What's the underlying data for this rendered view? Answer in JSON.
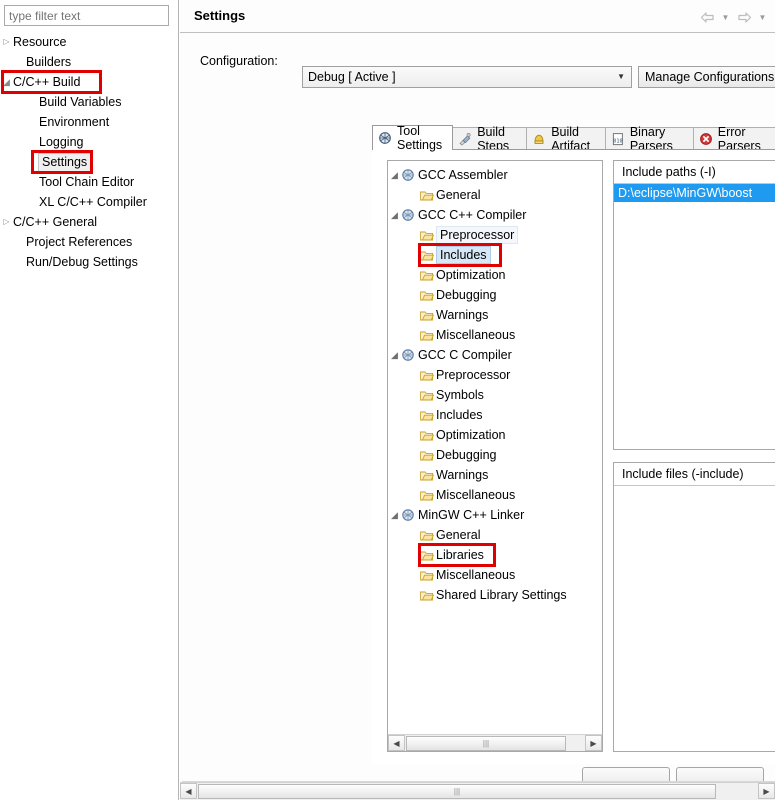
{
  "sidebar": {
    "filter": {
      "placeholder": "type filter text",
      "value": ""
    },
    "items": [
      {
        "label": "Resource",
        "arrow": "collapsed",
        "indent": 4,
        "selected": false,
        "boxed": false
      },
      {
        "label": "Builders",
        "arrow": "none",
        "indent": 17,
        "selected": false,
        "boxed": false
      },
      {
        "label": "C/C++ Build",
        "arrow": "expanded",
        "indent": 4,
        "selected": false,
        "boxed": true
      },
      {
        "label": "Build Variables",
        "arrow": "none",
        "indent": 30,
        "selected": false,
        "boxed": false
      },
      {
        "label": "Environment",
        "arrow": "none",
        "indent": 30,
        "selected": false,
        "boxed": false
      },
      {
        "label": "Logging",
        "arrow": "none",
        "indent": 30,
        "selected": false,
        "boxed": false
      },
      {
        "label": "Settings",
        "arrow": "none",
        "indent": 30,
        "selected": true,
        "boxed": true
      },
      {
        "label": "Tool Chain Editor",
        "arrow": "none",
        "indent": 30,
        "selected": false,
        "boxed": false
      },
      {
        "label": "XL C/C++ Compiler",
        "arrow": "none",
        "indent": 30,
        "selected": false,
        "boxed": false
      },
      {
        "label": "C/C++ General",
        "arrow": "collapsed",
        "indent": 4,
        "selected": false,
        "boxed": false
      },
      {
        "label": "Project References",
        "arrow": "none",
        "indent": 17,
        "selected": false,
        "boxed": false
      },
      {
        "label": "Run/Debug Settings",
        "arrow": "none",
        "indent": 17,
        "selected": false,
        "boxed": false
      }
    ]
  },
  "header": {
    "title": "Settings",
    "back_icon": "back-arrow-icon",
    "back_caret_icon": "chevron-down-icon",
    "forward_icon": "forward-arrow-icon",
    "forward_caret_icon": "chevron-down-icon"
  },
  "config": {
    "label": "Configuration:",
    "value": "Debug  [ Active ]",
    "caret_icon": "chevron-down-icon",
    "manage_button": "Manage Configurations..."
  },
  "tabs": [
    {
      "label": "Tool Settings",
      "icon": "tool-settings-icon",
      "active": true
    },
    {
      "label": "Build Steps",
      "icon": "build-steps-icon",
      "active": false
    },
    {
      "label": "Build Artifact",
      "icon": "build-artifact-icon",
      "active": false
    },
    {
      "label": "Binary Parsers",
      "icon": "binary-parsers-icon",
      "active": false
    },
    {
      "label": "Error Parsers",
      "icon": "error-parsers-icon",
      "active": false
    }
  ],
  "tool_tree": [
    {
      "label": "GCC Assembler",
      "arrow": "expanded",
      "indent": 6,
      "icon": "tool-gear-icon",
      "state": "normal",
      "boxed": false
    },
    {
      "label": "General",
      "arrow": "none",
      "indent": 24,
      "icon": "folder-icon",
      "state": "normal",
      "boxed": false
    },
    {
      "label": "GCC C++ Compiler",
      "arrow": "expanded",
      "indent": 6,
      "icon": "tool-gear-icon",
      "state": "normal",
      "boxed": false
    },
    {
      "label": "Preprocessor",
      "arrow": "none",
      "indent": 24,
      "icon": "folder-icon",
      "state": "faint",
      "boxed": false
    },
    {
      "label": "Includes",
      "arrow": "none",
      "indent": 24,
      "icon": "folder-icon",
      "state": "selected",
      "boxed": true
    },
    {
      "label": "Optimization",
      "arrow": "none",
      "indent": 24,
      "icon": "folder-icon",
      "state": "normal",
      "boxed": false
    },
    {
      "label": "Debugging",
      "arrow": "none",
      "indent": 24,
      "icon": "folder-icon",
      "state": "normal",
      "boxed": false
    },
    {
      "label": "Warnings",
      "arrow": "none",
      "indent": 24,
      "icon": "folder-icon",
      "state": "normal",
      "boxed": false
    },
    {
      "label": "Miscellaneous",
      "arrow": "none",
      "indent": 24,
      "icon": "folder-icon",
      "state": "normal",
      "boxed": false
    },
    {
      "label": "GCC C Compiler",
      "arrow": "expanded",
      "indent": 6,
      "icon": "tool-gear-icon",
      "state": "normal",
      "boxed": false
    },
    {
      "label": "Preprocessor",
      "arrow": "none",
      "indent": 24,
      "icon": "folder-icon",
      "state": "normal",
      "boxed": false
    },
    {
      "label": "Symbols",
      "arrow": "none",
      "indent": 24,
      "icon": "folder-icon",
      "state": "normal",
      "boxed": false
    },
    {
      "label": "Includes",
      "arrow": "none",
      "indent": 24,
      "icon": "folder-icon",
      "state": "normal",
      "boxed": false
    },
    {
      "label": "Optimization",
      "arrow": "none",
      "indent": 24,
      "icon": "folder-icon",
      "state": "normal",
      "boxed": false
    },
    {
      "label": "Debugging",
      "arrow": "none",
      "indent": 24,
      "icon": "folder-icon",
      "state": "normal",
      "boxed": false
    },
    {
      "label": "Warnings",
      "arrow": "none",
      "indent": 24,
      "icon": "folder-icon",
      "state": "normal",
      "boxed": false
    },
    {
      "label": "Miscellaneous",
      "arrow": "none",
      "indent": 24,
      "icon": "folder-icon",
      "state": "normal",
      "boxed": false
    },
    {
      "label": "MinGW C++ Linker",
      "arrow": "expanded",
      "indent": 6,
      "icon": "tool-gear-icon",
      "state": "normal",
      "boxed": false
    },
    {
      "label": "General",
      "arrow": "none",
      "indent": 24,
      "icon": "folder-icon",
      "state": "normal",
      "boxed": false
    },
    {
      "label": "Libraries",
      "arrow": "none",
      "indent": 24,
      "icon": "folder-icon",
      "state": "normal",
      "boxed": true
    },
    {
      "label": "Miscellaneous",
      "arrow": "none",
      "indent": 24,
      "icon": "folder-icon",
      "state": "normal",
      "boxed": false
    },
    {
      "label": "Shared Library Settings",
      "arrow": "none",
      "indent": 24,
      "icon": "folder-icon",
      "state": "normal",
      "boxed": false
    }
  ],
  "include_paths": {
    "title": "Include paths (-I)",
    "tools": [
      {
        "icon": "add-icon",
        "enabled": true
      },
      {
        "icon": "delete-icon",
        "enabled": true
      },
      {
        "icon": "edit-icon",
        "enabled": true
      },
      {
        "icon": "move-up-icon",
        "enabled": false
      },
      {
        "icon": "move-down-icon",
        "enabled": false
      }
    ],
    "items": [
      "D:\\eclipse\\MinGW\\boost"
    ],
    "selected_index": 0
  },
  "include_files": {
    "title": "Include files (-include)",
    "tools": [
      {
        "icon": "add-icon",
        "enabled": true
      },
      {
        "icon": "delete-icon",
        "enabled": false
      },
      {
        "icon": "edit-icon",
        "enabled": false
      },
      {
        "icon": "move-up-icon",
        "enabled": false
      },
      {
        "icon": "move-down-icon",
        "enabled": false
      }
    ],
    "items": []
  },
  "scrollbars": {
    "left_arrow_icon": "scroll-left-icon",
    "right_arrow_icon": "scroll-right-icon",
    "grip_icon": "grip-icon"
  },
  "colors": {
    "selection_blue": "#1e9bf0",
    "tree_selection": "#d6e7f7",
    "annotation_red": "#e00000",
    "panel_border": "#a8a8a8"
  }
}
